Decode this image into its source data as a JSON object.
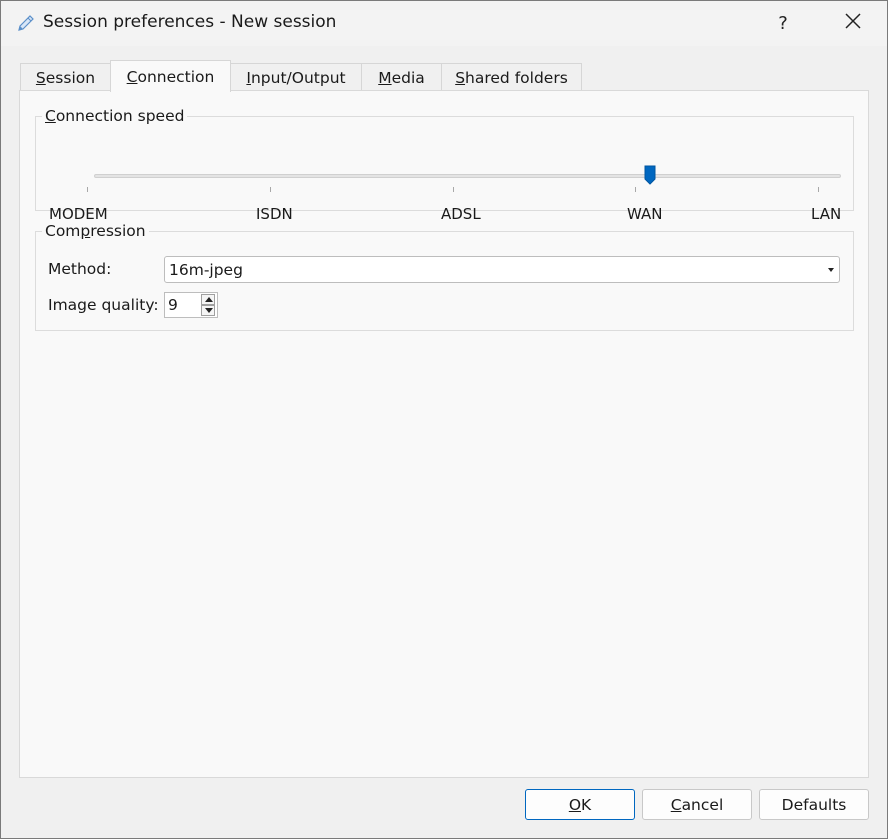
{
  "window": {
    "title": "Session preferences - New session",
    "help_label": "?",
    "icons": {
      "app": "pencil-icon",
      "close": "close-icon"
    }
  },
  "tabs": [
    {
      "label": "Session",
      "mnemonic": "S",
      "rest": "ession",
      "active": false
    },
    {
      "label": "Connection",
      "mnemonic": "C",
      "rest": "onnection",
      "active": true
    },
    {
      "label": "Input/Output",
      "mnemonic": "I",
      "rest": "nput/Output",
      "active": false
    },
    {
      "label": "Media",
      "mnemonic": "M",
      "rest": "edia",
      "active": false
    },
    {
      "label": "Shared folders",
      "mnemonic": "S",
      "rest": "hared folders",
      "active": false
    }
  ],
  "connection_speed": {
    "legend_mnemonic": "C",
    "legend_rest": "onnection speed",
    "options": [
      "MODEM",
      "ISDN",
      "ADSL",
      "WAN",
      "LAN"
    ],
    "selected": "WAN",
    "selected_index": 3
  },
  "compression": {
    "legend_pre": "Com",
    "legend_mnemonic": "p",
    "legend_rest": "ression",
    "method_label": "Method:",
    "method_value": "16m-jpeg",
    "quality_label": "Image quality:",
    "quality_value": "9"
  },
  "buttons": {
    "ok_mnemonic": "O",
    "ok_rest": "K",
    "cancel_mnemonic": "C",
    "cancel_rest": "ancel",
    "defaults": "Defaults"
  },
  "colors": {
    "accent": "#0067c0",
    "panel": "#f9f9f9",
    "window": "#f0f0f0"
  }
}
